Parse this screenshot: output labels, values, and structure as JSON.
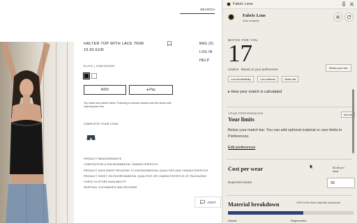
{
  "colors": {
    "panel_bg": "#efece5",
    "accent": "#2f3f7a",
    "logo_ring": "#c8a94f"
  },
  "store": {
    "search_label": "SEARCH",
    "product_title": "HALTER TOP WITH LACE TRIM",
    "price": "19.95 EUR",
    "nav": [
      "BAG (0)",
      "LOG IN",
      "HELP"
    ],
    "color_name": "BLACK | 0285/400/800",
    "swatches": [
      "black",
      "white"
    ],
    "add_label": "ADD",
    "pay_label": "Pay",
    "description": "Top made from stretch fabric. Featuring a contrast neckline and thin straps with matching lace trim.",
    "complete_look": "COMPLETE YOUR LOOK",
    "links": [
      "PRODUCT MEASUREMENTS",
      "COMPOSITION & ENVIRONMENTAL CHARACTERISTICS",
      "PRODUCT DATA SHEET RELATING TO ENVIRONMENTAL QUALITIES AND CHARACTERISTICS",
      "PRODUCT SHEET ON ENVIRONMENTAL QUALITIES OR CHARACTERISTICS OF PACKAGING",
      "CHECK IN-STORE AVAILABILITY",
      "SHIPPING, EXCHANGES AND RETURNS"
    ],
    "chat_label": "CHAT"
  },
  "panel": {
    "window_title": "Fabric Lens",
    "app_name": "Fabric Lens",
    "app_sub": "Zara analysis",
    "match_label": "MATCH FOR YOU",
    "match_value": "17",
    "caution": "Caution · Based on your preferences",
    "below_bar": "Below your bar",
    "chips": [
      "Low breathability",
      "Low softness",
      "Static risk"
    ],
    "how_match": "How your match is calculated",
    "prefs_label": "YOUR PREFERENCES",
    "not_set": "Not set",
    "your_limits": "Your limits",
    "limits_text": "Below your match bar. You can add optional material or care limits in Preferences.",
    "edit_prefs": "Edit preferences",
    "cost_title": "Cost per wear",
    "cost_value": "€0.66 per wear",
    "expected_wears_label": "Expected wears",
    "expected_wears_value": "30",
    "material_title": "Material breakdown",
    "material_note": "100% of the listed materials understood",
    "material_natural_fraction": 0.6,
    "material_legend": [
      "Natural",
      "Regenerated"
    ]
  }
}
